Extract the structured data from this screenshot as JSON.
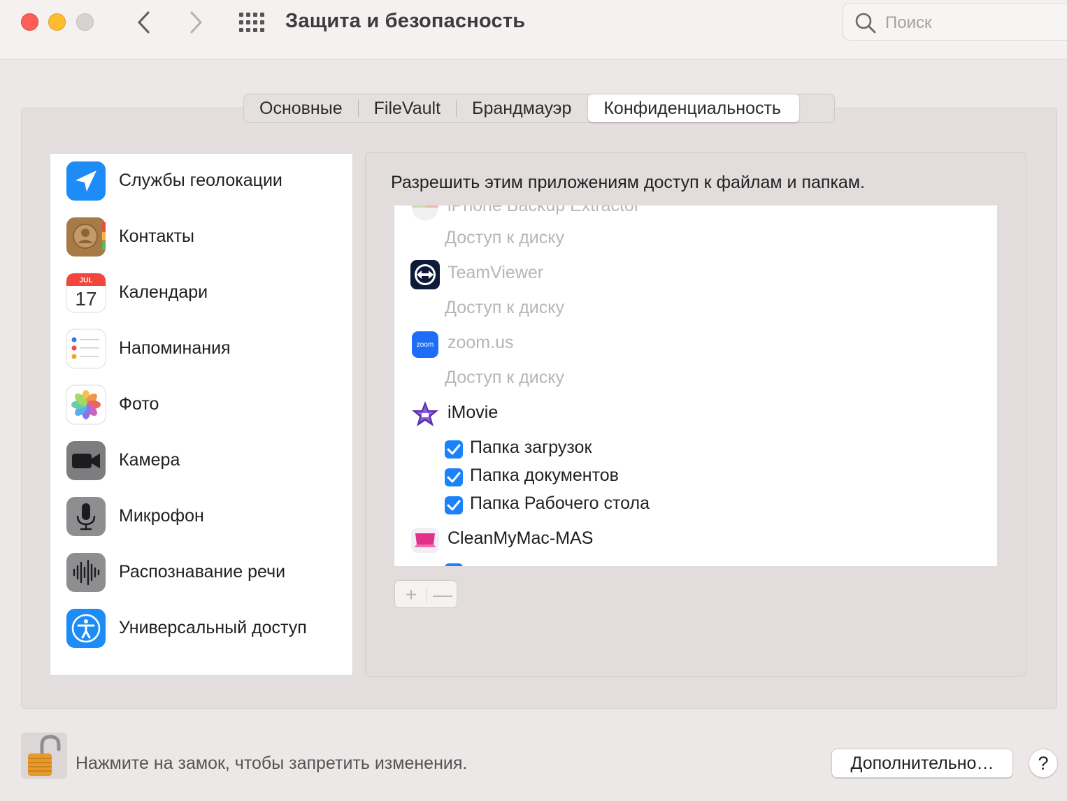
{
  "window": {
    "title": "Защита и безопасность",
    "search_placeholder": "Поиск"
  },
  "tabs": [
    {
      "label": "Основные",
      "active": false
    },
    {
      "label": "FileVault",
      "active": false
    },
    {
      "label": "Брандмауэр",
      "active": false
    },
    {
      "label": "Конфиденциальность",
      "active": true
    }
  ],
  "sidebar": {
    "items": [
      {
        "label": "Службы геолокации",
        "icon": "location-icon"
      },
      {
        "label": "Контакты",
        "icon": "contacts-icon"
      },
      {
        "label": "Календари",
        "icon": "calendar-icon",
        "icon_month": "JUL",
        "icon_day": "17"
      },
      {
        "label": "Напоминания",
        "icon": "reminders-icon"
      },
      {
        "label": "Фото",
        "icon": "photos-icon"
      },
      {
        "label": "Камера",
        "icon": "camera-icon"
      },
      {
        "label": "Микрофон",
        "icon": "microphone-icon"
      },
      {
        "label": "Распознавание речи",
        "icon": "speech-recognition-icon"
      },
      {
        "label": "Универсальный доступ",
        "icon": "accessibility-icon"
      }
    ]
  },
  "content": {
    "title": "Разрешить этим приложениям доступ к файлам и папкам.",
    "apps": [
      {
        "name": "iPhone Backup Extractor",
        "icon": "iphone-backup-extractor-icon",
        "sub": "Доступ к диску",
        "dimmed": true
      },
      {
        "name": "TeamViewer",
        "icon": "teamviewer-icon",
        "sub": "Доступ к диску",
        "dimmed": true
      },
      {
        "name": "zoom.us",
        "icon": "zoom-icon",
        "icon_text": "zoom",
        "sub": "Доступ к диску",
        "dimmed": true
      },
      {
        "name": "iMovie",
        "icon": "imovie-icon",
        "dimmed": false,
        "folders": [
          {
            "label": "Папка загрузок",
            "checked": true
          },
          {
            "label": "Папка документов",
            "checked": true
          },
          {
            "label": "Папка Рабочего стола",
            "checked": true
          }
        ]
      },
      {
        "name": "CleanMyMac-MAS",
        "icon": "cleanmymac-icon",
        "dimmed": false
      }
    ],
    "add_label": "+",
    "remove_label": "—"
  },
  "footer": {
    "lock_text": "Нажмите на замок, чтобы запретить изменения.",
    "advanced_label": "Дополнительно…",
    "help_label": "?"
  },
  "colors": {
    "accent": "#1a82fb",
    "close": "#fe5f57",
    "minimize": "#febc2e",
    "panel": "#e4dfde"
  }
}
